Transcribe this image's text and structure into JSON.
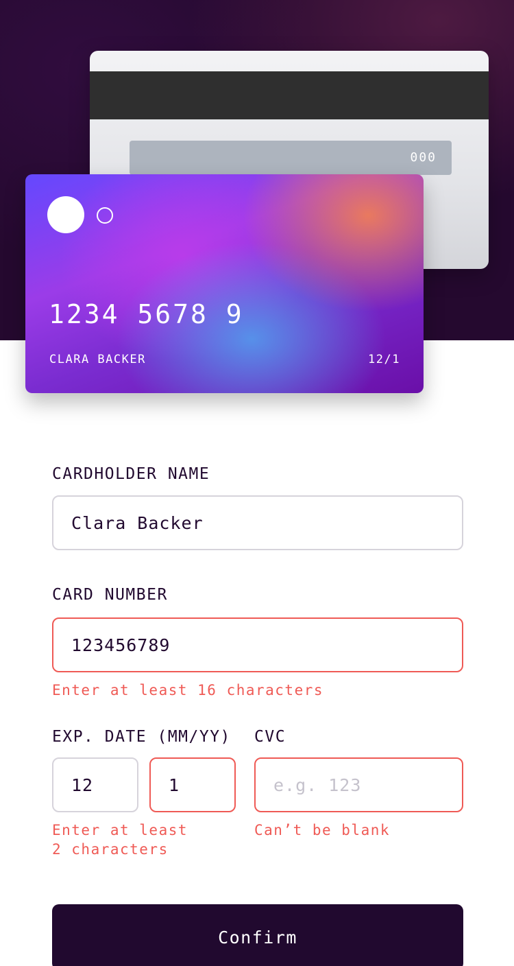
{
  "card_back": {
    "cvc": "000"
  },
  "card_front": {
    "number": "1234 5678 9",
    "name": "CLARA BACKER",
    "expiry": "12/1"
  },
  "form": {
    "cardholder_label": "CARDHOLDER NAME",
    "cardholder_value": "Clara Backer",
    "number_label": "CARD NUMBER",
    "number_value": "123456789",
    "number_error": "Enter at least 16 characters",
    "exp_label": "EXP. DATE (MM/YY)",
    "exp_month_value": "12",
    "exp_year_value": "1",
    "exp_error_line1": "Enter at least",
    "exp_error_line2": "2 characters",
    "cvc_label": "CVC",
    "cvc_placeholder": "e.g. 123",
    "cvc_error": "Can’t be blank"
  },
  "confirm_label": "Confirm",
  "colors": {
    "hero_bg": "#25092f",
    "text_dark": "#21092f",
    "error": "#ef5a55",
    "border": "#d6d3db",
    "button_bg": "#21092f"
  }
}
